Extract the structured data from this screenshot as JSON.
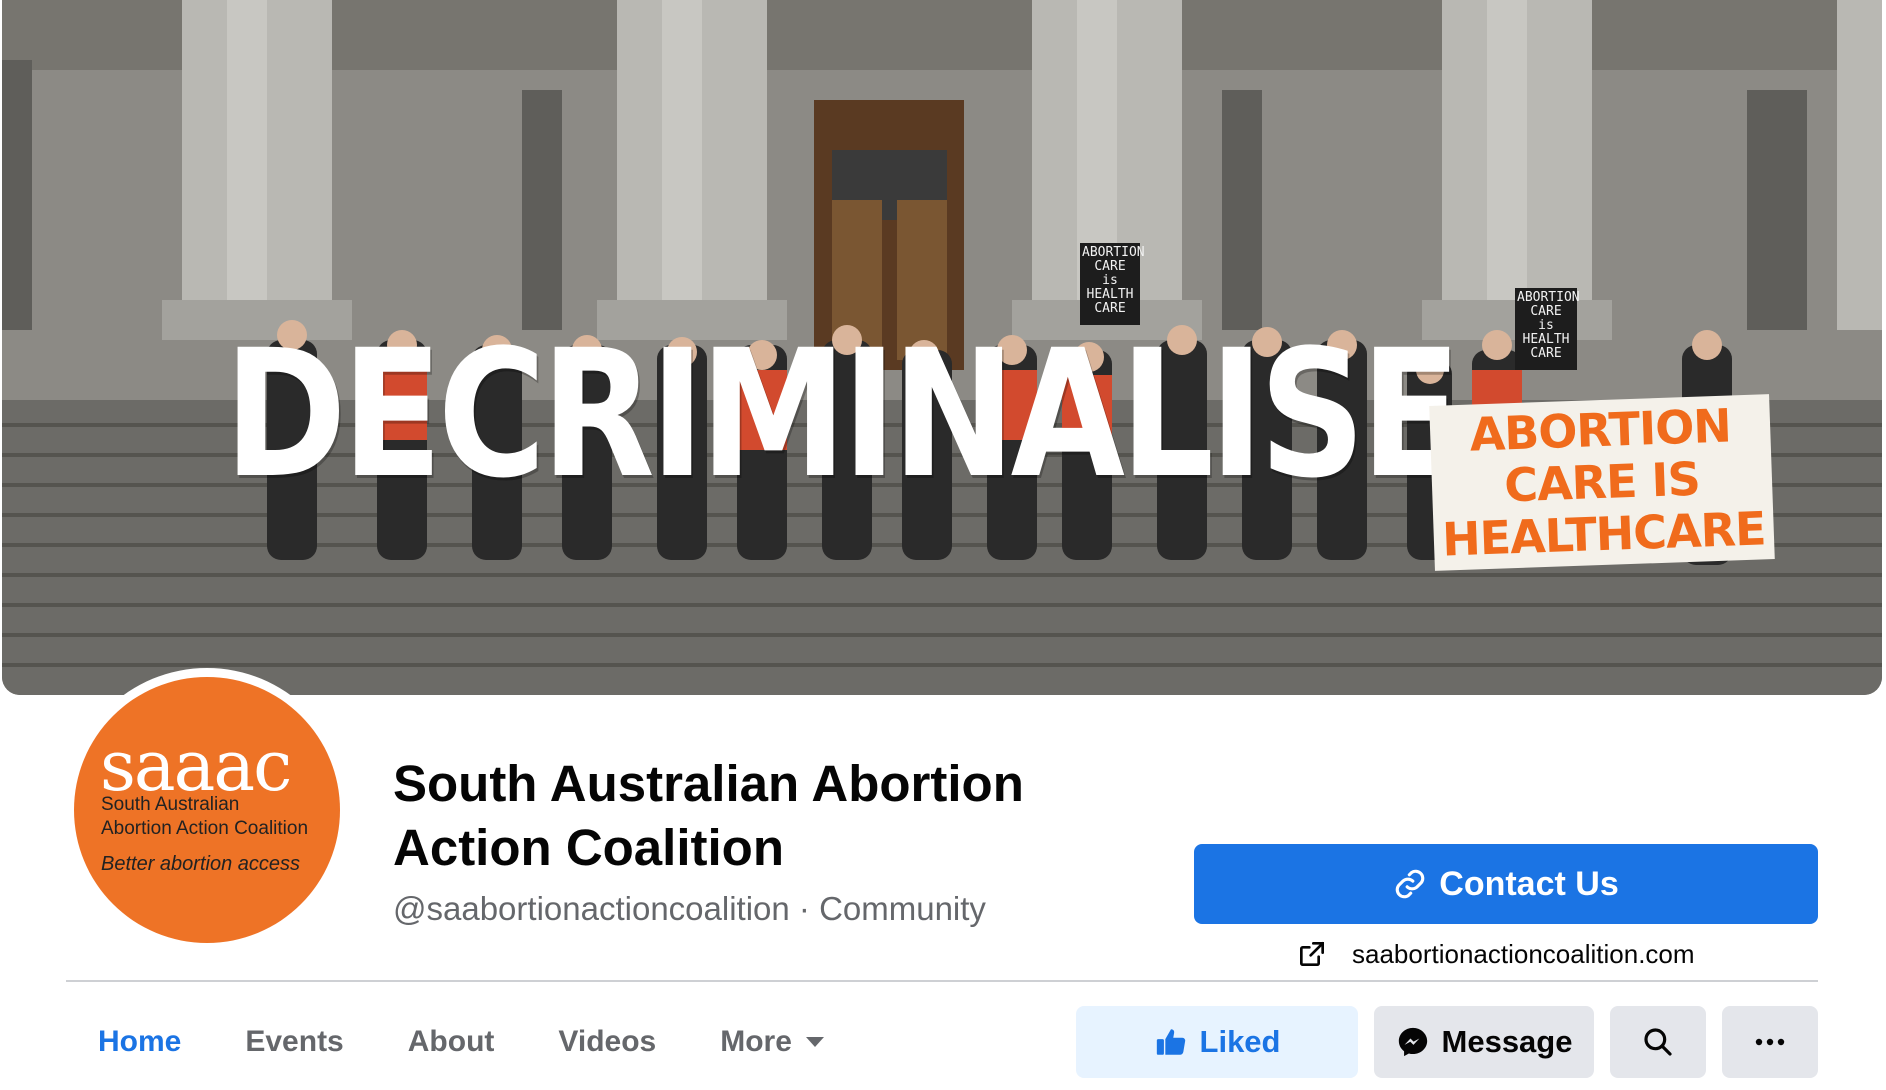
{
  "cover": {
    "headline": "DECRIMINALISE",
    "banner_lines": [
      "ABORTION",
      "CARE IS",
      "HEALTHCARE"
    ],
    "sign_lines": [
      "ABORTION",
      "CARE",
      "is",
      "HEALTH",
      "CARE"
    ]
  },
  "avatar": {
    "brand": "saaac",
    "line1": "South Australian",
    "line2": "Abortion Action Coalition",
    "tagline": "Better abortion access"
  },
  "page": {
    "name": "South Australian Abortion Action Coalition",
    "handle_category": "@saabortionactioncoalition · Community"
  },
  "contact": {
    "label": "Contact Us"
  },
  "website": {
    "url": "saabortionactioncoalition.com"
  },
  "tabs": [
    {
      "label": "Home",
      "active": true
    },
    {
      "label": "Events"
    },
    {
      "label": "About"
    },
    {
      "label": "Videos"
    },
    {
      "label": "More"
    }
  ],
  "actions": {
    "liked": "Liked",
    "message": "Message"
  },
  "colors": {
    "accent": "#1b74e4",
    "brand_orange": "#ee7326",
    "secondary_text": "#65676b"
  }
}
